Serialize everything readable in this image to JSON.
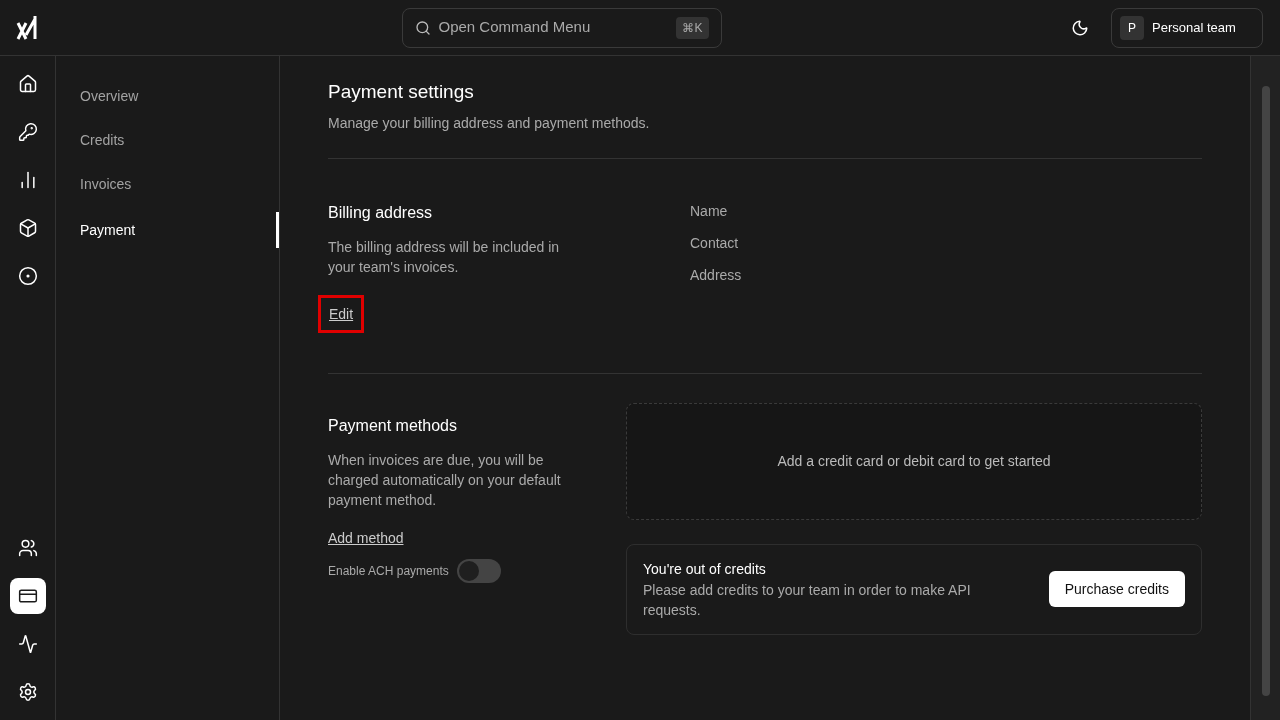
{
  "header": {
    "command": {
      "label": "Open Command Menu",
      "shortcut": "⌘K"
    },
    "team": {
      "initial": "P",
      "name": "Personal team"
    }
  },
  "rail": [
    {
      "kind": "home",
      "selected": false
    },
    {
      "kind": "key",
      "selected": false
    },
    {
      "kind": "chart",
      "selected": false
    },
    {
      "kind": "box",
      "selected": false
    },
    {
      "kind": "target",
      "selected": false
    },
    {
      "kind": "team",
      "selected": false
    },
    {
      "kind": "billing",
      "selected": true
    },
    {
      "kind": "activity",
      "selected": false
    },
    {
      "kind": "settings",
      "selected": false
    }
  ],
  "subnav": [
    {
      "label": "Overview",
      "selected": false
    },
    {
      "label": "Credits",
      "selected": false
    },
    {
      "label": "Invoices",
      "selected": false
    },
    {
      "label": "Payment",
      "selected": true
    }
  ],
  "page": {
    "title": "Payment settings",
    "subtitle": "Manage your billing address and payment methods."
  },
  "billing": {
    "title": "Billing address",
    "description": "The billing address will be included in your team's invoices.",
    "edit": {
      "label": "Edit",
      "highlighted": true
    },
    "fields": [
      "Name",
      "Contact",
      "Address"
    ]
  },
  "methods": {
    "title": "Payment methods",
    "description": "When invoices are due, you will be charged automatically on your default payment method.",
    "add": "Add method",
    "ach": {
      "label": "Enable ACH payments",
      "on": false
    },
    "empty": "Add a credit card or debit card to get started"
  },
  "credits_notice": {
    "title": "You're out of credits",
    "message": "Please add credits to your team in order to make API requests.",
    "button": "Purchase credits"
  }
}
